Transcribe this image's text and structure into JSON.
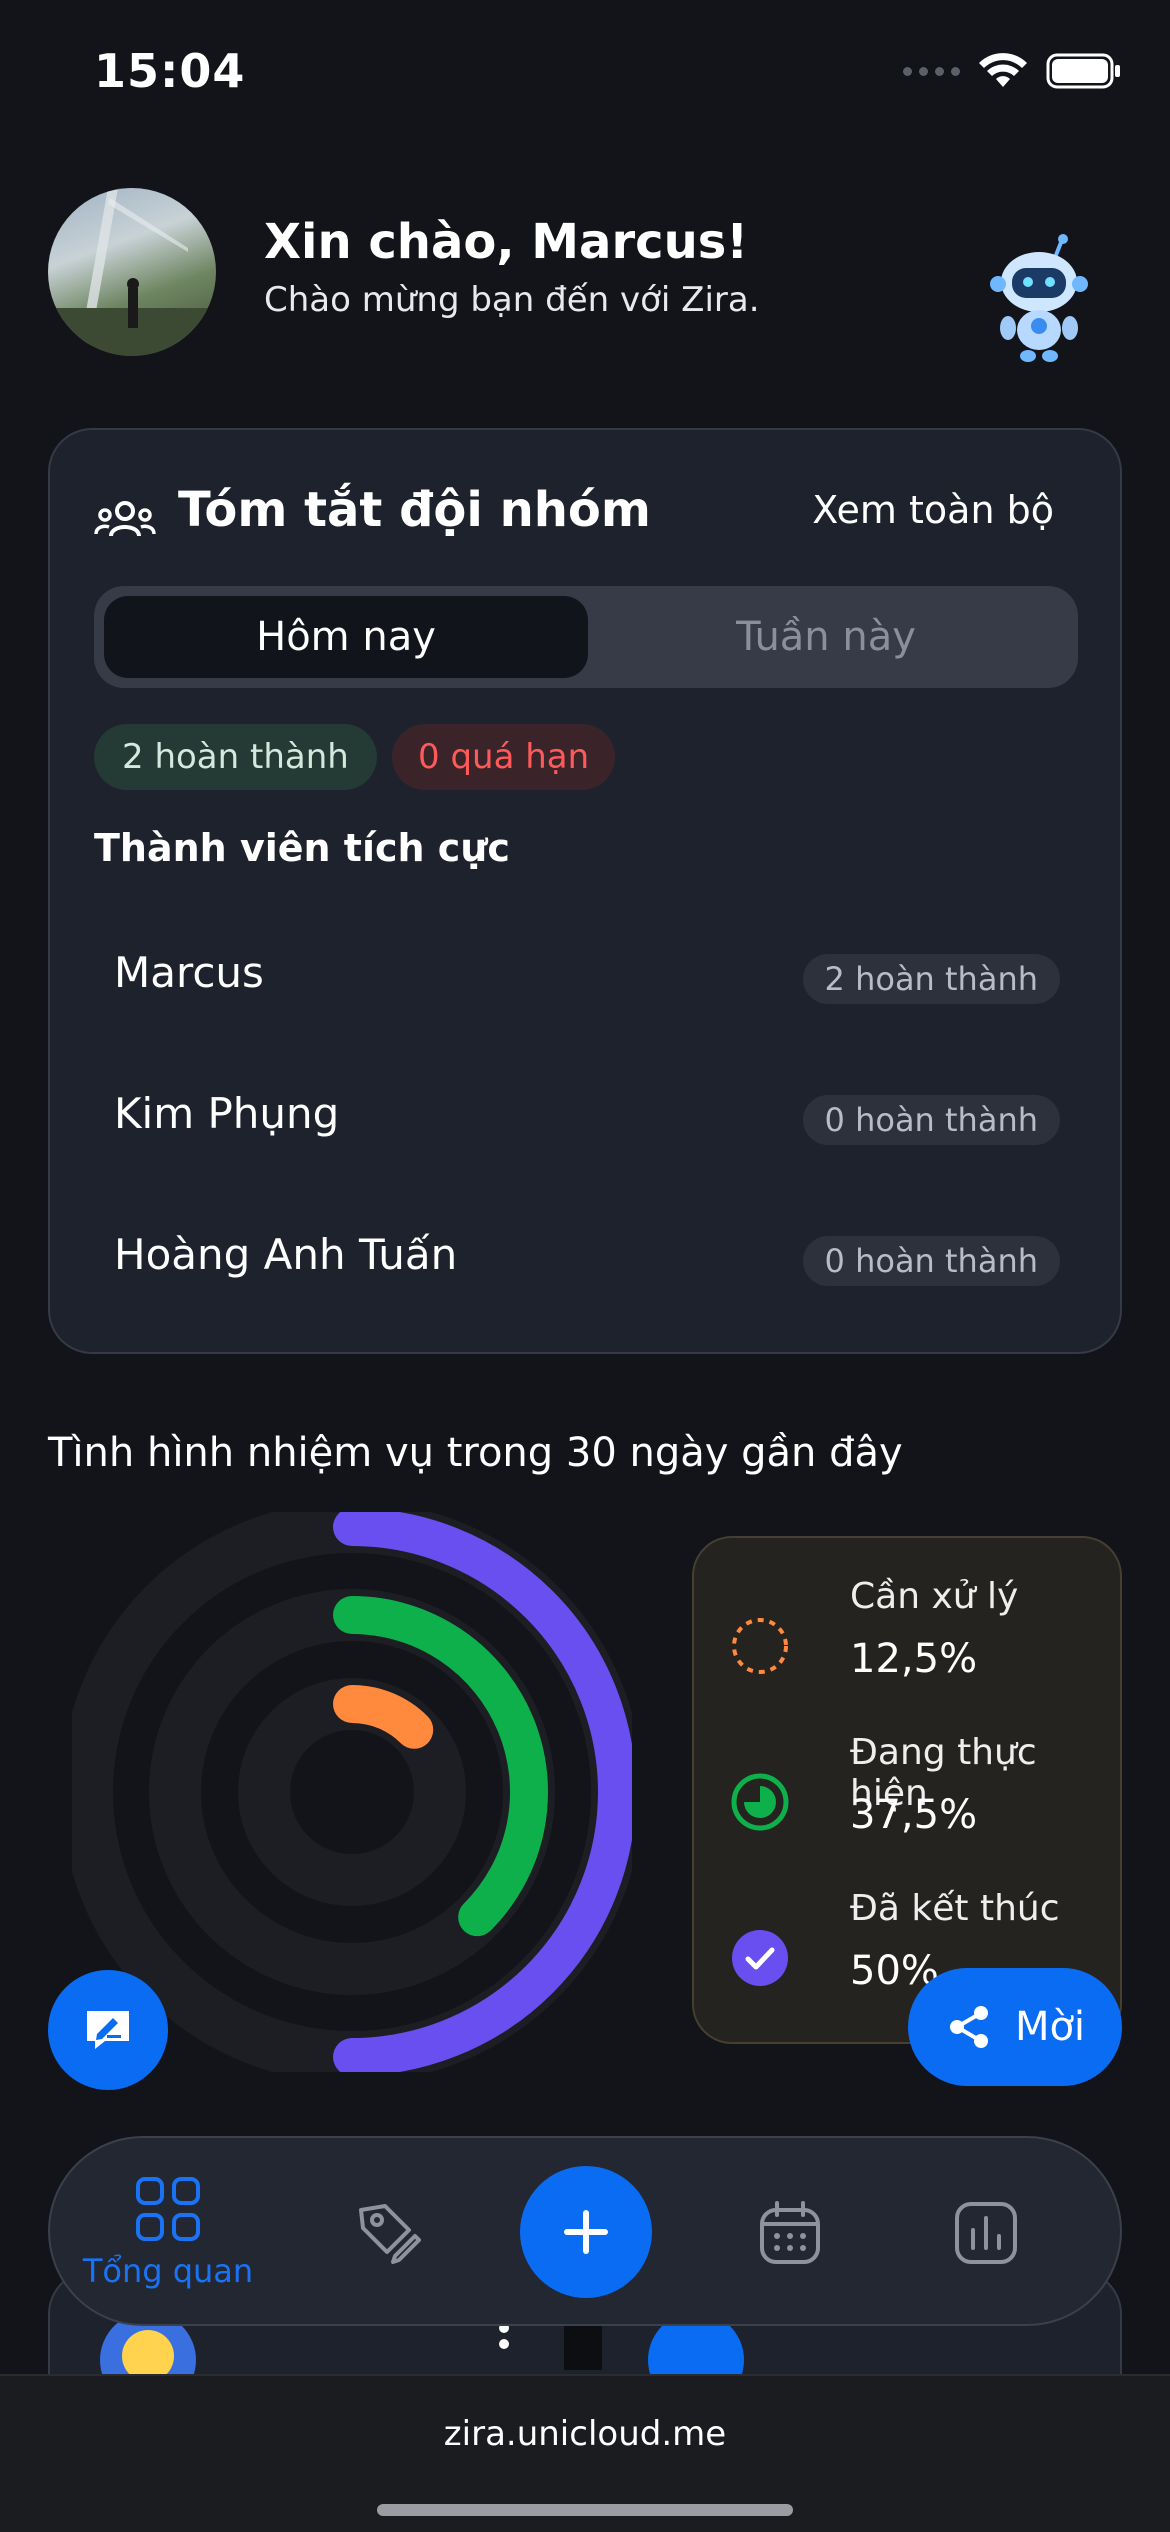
{
  "status_bar": {
    "time": "15:04"
  },
  "header": {
    "greeting": "Xin chào, Marcus!",
    "subtitle": "Chào mừng bạn đến với Zira."
  },
  "team_summary": {
    "title": "Tóm tắt đội nhóm",
    "view_all": "Xem toàn bộ",
    "tabs": [
      {
        "label": "Hôm nay",
        "active": true
      },
      {
        "label": "Tuần này",
        "active": false
      }
    ],
    "completed_badge": "2 hoàn thành",
    "overdue_badge": "0 quá hạn",
    "members_title": "Thành viên tích cực",
    "members": [
      {
        "name": "Marcus",
        "badge": "2 hoàn thành"
      },
      {
        "name": "Kim Phụng",
        "badge": "0 hoàn thành"
      },
      {
        "name": "Hoàng Anh Tuấn",
        "badge": "0 hoàn thành"
      }
    ]
  },
  "tasks_section": {
    "title": "Tình hình nhiệm vụ trong 30 ngày gần đây"
  },
  "chart_data": {
    "type": "radial-bar",
    "series": [
      {
        "name": "Cần xử lý",
        "value": 12.5,
        "label": "12,5%",
        "color": "#ff8a3d"
      },
      {
        "name": "Đang thực hiện",
        "value": 37.5,
        "label": "37,5%",
        "color": "#0db04b"
      },
      {
        "name": "Đã kết thúc",
        "value": 50,
        "label": "50%",
        "color": "#6a4ff0"
      }
    ],
    "max": 100
  },
  "fab": {
    "invite_label": "Mời"
  },
  "tabbar": {
    "items": [
      {
        "label": "Tổng quan",
        "icon": "grid-icon",
        "active": true
      },
      {
        "label": "",
        "icon": "tag-edit-icon",
        "active": false
      },
      {
        "label": "",
        "icon": "plus-icon",
        "active": false
      },
      {
        "label": "",
        "icon": "calendar-icon",
        "active": false
      },
      {
        "label": "",
        "icon": "chart-icon",
        "active": false
      }
    ]
  },
  "browser": {
    "url": "zira.unicloud.me"
  },
  "colors": {
    "accent": "#0a6cf2",
    "background": "#12141a",
    "card": "#1e222c",
    "overdue": "#ff5a5a"
  }
}
